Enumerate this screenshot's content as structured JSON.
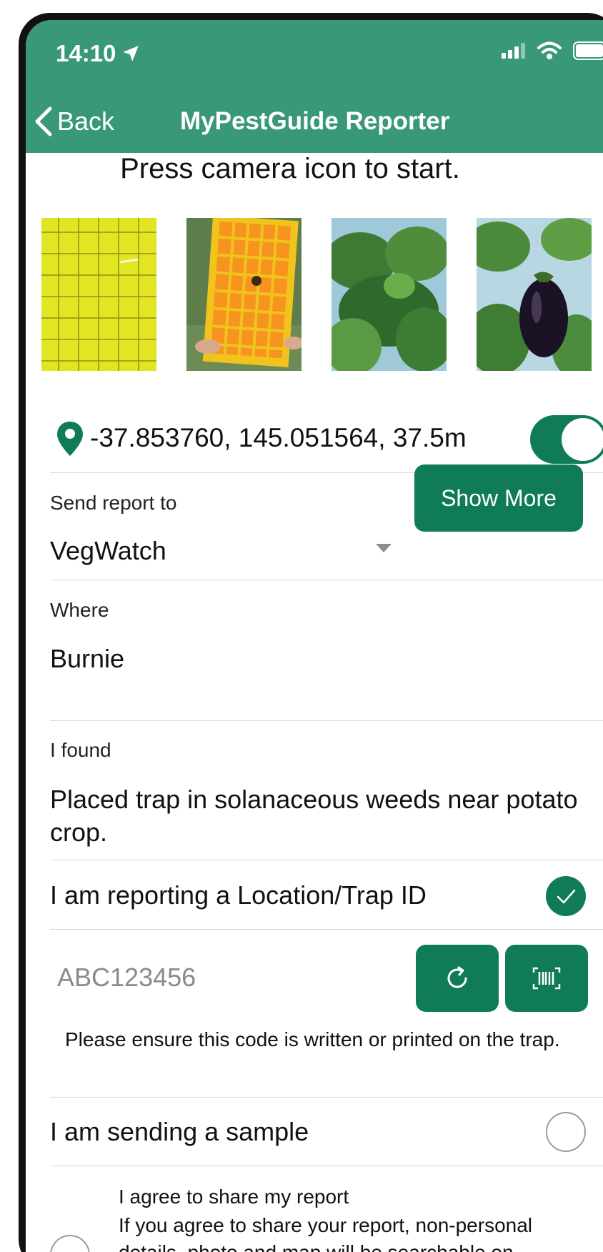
{
  "status_bar": {
    "time": "14:10"
  },
  "nav": {
    "back_label": "Back",
    "title": "MyPestGuide Reporter"
  },
  "prompt": "Press camera icon to start.",
  "photos": [
    {
      "name": "photo-sticky-trap-grid"
    },
    {
      "name": "photo-orange-trap-held"
    },
    {
      "name": "photo-plant-foliage"
    },
    {
      "name": "photo-eggplant"
    }
  ],
  "location": {
    "coordinates": "-37.853760, 145.051564, 37.5m",
    "enabled": true
  },
  "send_report": {
    "label": "Send report to",
    "value": "VegWatch",
    "show_more_label": "Show More"
  },
  "where": {
    "label": "Where",
    "value": "Burnie"
  },
  "found": {
    "label": "I found",
    "value": "Placed trap in solanaceous weeds near potato crop."
  },
  "trap_id": {
    "label": "I am reporting a Location/Trap ID",
    "checked": true,
    "placeholder": "ABC123456",
    "hint": "Please ensure this code is written or printed on the trap."
  },
  "sample": {
    "label": "I am sending a sample",
    "checked": false
  },
  "share": {
    "label": "I agree to share my report",
    "description": "If you agree to share your report, non-personal details, photo and map will be searchable on",
    "checked": false
  },
  "colors": {
    "header": "#389878",
    "accent": "#107c55"
  }
}
